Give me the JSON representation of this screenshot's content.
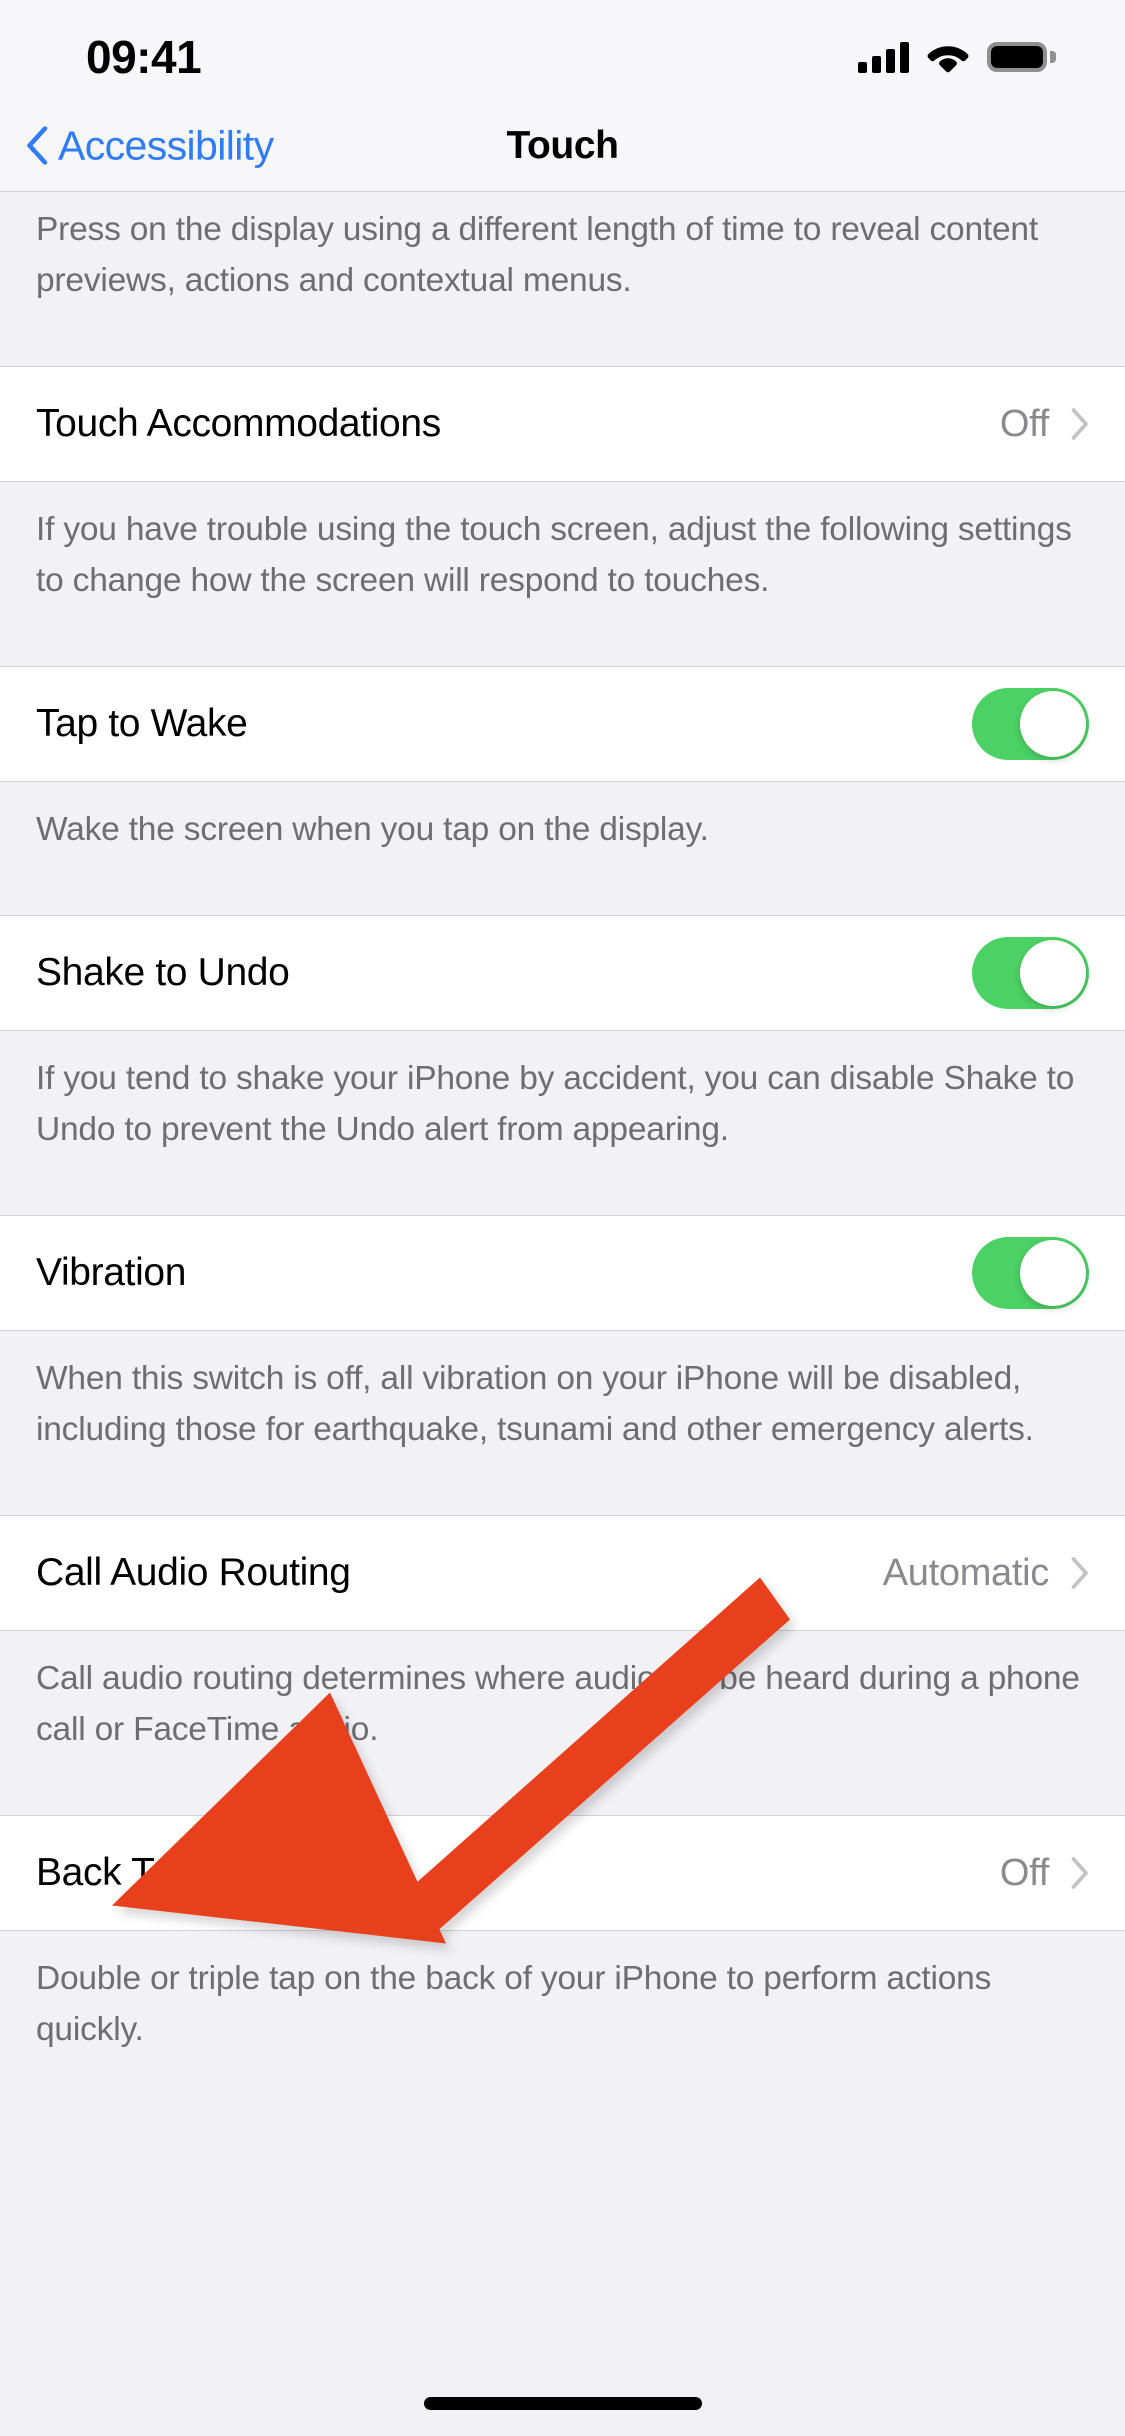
{
  "status_bar": {
    "time": "09:41",
    "cellular_icon": "cellular-signal-icon",
    "cellular_bars": 4,
    "wifi_icon": "wifi-icon",
    "battery_icon": "battery-full-icon"
  },
  "nav": {
    "back_label": "Accessibility",
    "back_icon": "chevron-left-icon",
    "title": "Touch"
  },
  "theme": {
    "accent_blue": "#2F7CF6",
    "switch_on_green": "#4CD264",
    "group_background": "#F1F1F6",
    "row_background": "#FFFFFF",
    "separator": "#D2D2D6",
    "secondary_text": "#8A8A8E",
    "footer_text": "#6D6D72",
    "annotation_red": "#E8401F"
  },
  "sections": [
    {
      "id": "haptic-touch-footer",
      "partial_top": true,
      "footer": "Press on the display using a different length of time to reveal content previews, actions and contextual menus."
    },
    {
      "id": "touch-accommodations",
      "row": {
        "label": "Touch Accommodations",
        "type": "disclosure",
        "value": "Off",
        "chevron": "chevron-right-icon"
      },
      "footer": "If you have trouble using the touch screen, adjust the following settings to change how the screen will respond to touches."
    },
    {
      "id": "tap-to-wake",
      "row": {
        "label": "Tap to Wake",
        "type": "switch",
        "value": "on"
      },
      "footer": "Wake the screen when you tap on the display."
    },
    {
      "id": "shake-to-undo",
      "row": {
        "label": "Shake to Undo",
        "type": "switch",
        "value": "on"
      },
      "footer": "If you tend to shake your iPhone by accident, you can disable Shake to Undo to prevent the Undo alert from appearing."
    },
    {
      "id": "vibration",
      "row": {
        "label": "Vibration",
        "type": "switch",
        "value": "on"
      },
      "footer": "When this switch is off, all vibration on your iPhone will be disabled, including those for earthquake, tsunami and other emergency alerts."
    },
    {
      "id": "call-audio-routing",
      "row": {
        "label": "Call Audio Routing",
        "type": "disclosure",
        "value": "Automatic",
        "chevron": "chevron-right-icon"
      },
      "footer": "Call audio routing determines where audio will be heard during a phone call or FaceTime audio."
    },
    {
      "id": "back-tap",
      "row": {
        "label": "Back Tap",
        "type": "disclosure",
        "value": "Off",
        "chevron": "chevron-right-icon"
      },
      "footer": "Double or triple tap on the back of your iPhone to perform actions quickly."
    }
  ],
  "annotation": {
    "type": "arrow",
    "icon": "red-annotation-arrow",
    "color": "#E8401F",
    "points_to": "Back Tap"
  },
  "home_indicator": "home-indicator"
}
